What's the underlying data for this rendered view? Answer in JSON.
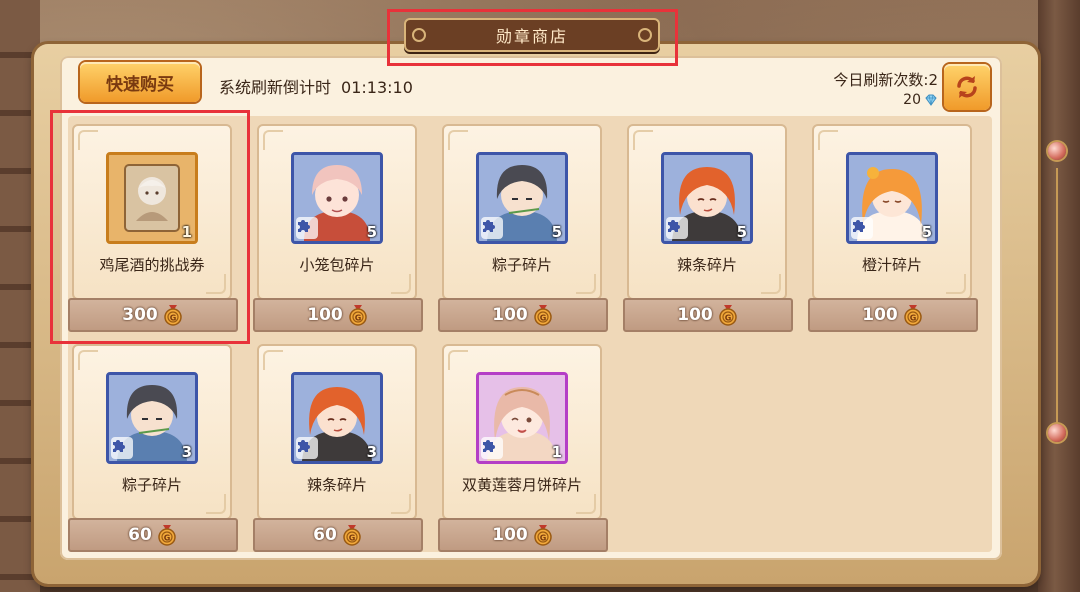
{
  "window": {
    "title": "勋章商店"
  },
  "toolbar": {
    "quick_buy_label": "快速购买",
    "countdown_label": "系统刷新倒计时",
    "countdown_value": "01:13:10",
    "refresh_count_label": "今日刷新次数:2",
    "refresh_cost": "20",
    "refresh_cost_icon": "diamond-icon",
    "refresh_icon": "refresh-icon"
  },
  "currency": {
    "icon": "medal-coin-icon"
  },
  "items": [
    {
      "name": "鸡尾酒的挑战券",
      "quantity": "1",
      "price": "300",
      "rarity": "gold",
      "type": "ticket"
    },
    {
      "name": "小笼包碎片",
      "quantity": "5",
      "price": "100",
      "rarity": "blue",
      "type": "fragment"
    },
    {
      "name": "粽子碎片",
      "quantity": "5",
      "price": "100",
      "rarity": "blue",
      "type": "fragment"
    },
    {
      "name": "辣条碎片",
      "quantity": "5",
      "price": "100",
      "rarity": "blue",
      "type": "fragment"
    },
    {
      "name": "橙汁碎片",
      "quantity": "5",
      "price": "100",
      "rarity": "blue",
      "type": "fragment"
    },
    {
      "name": "粽子碎片",
      "quantity": "3",
      "price": "60",
      "rarity": "blue",
      "type": "fragment"
    },
    {
      "name": "辣条碎片",
      "quantity": "3",
      "price": "60",
      "rarity": "blue",
      "type": "fragment"
    },
    {
      "name": "双黄莲蓉月饼碎片",
      "quantity": "1",
      "price": "100",
      "rarity": "purple",
      "type": "fragment"
    }
  ],
  "colors": {
    "highlight": "#e8323a",
    "rarity_blue": "#3d55a8",
    "rarity_purple": "#b43ec6",
    "rarity_gold": "#c87d1c"
  }
}
